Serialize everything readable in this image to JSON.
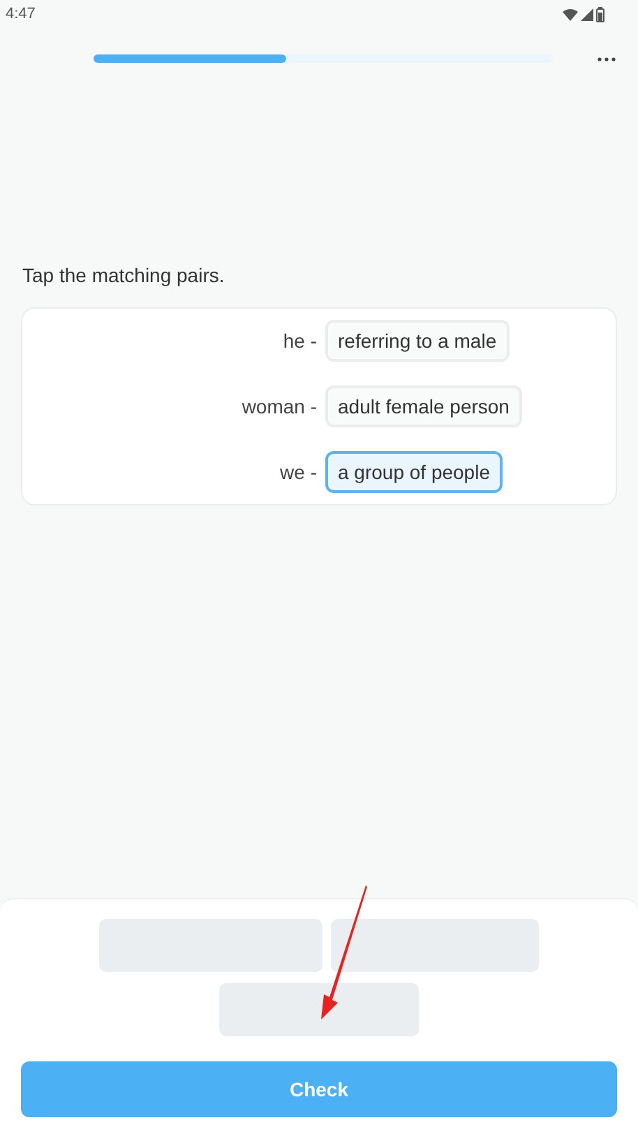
{
  "status_bar": {
    "time": "4:47"
  },
  "progress": {
    "level": 0.42
  },
  "instruction": "Tap the matching pairs.",
  "pairs": [
    {
      "word": "he -",
      "meaning": "referring to a male",
      "selected": false
    },
    {
      "word": "woman -",
      "meaning": "adult female person",
      "selected": false
    },
    {
      "word": "we -",
      "meaning": "a group of people",
      "selected": true
    }
  ],
  "answer_slots": [
    {
      "filled": false
    },
    {
      "filled": false
    },
    {
      "filled": false
    }
  ],
  "annotation_arrow": true,
  "check_button": {
    "label": "Check",
    "disabled": false
  }
}
